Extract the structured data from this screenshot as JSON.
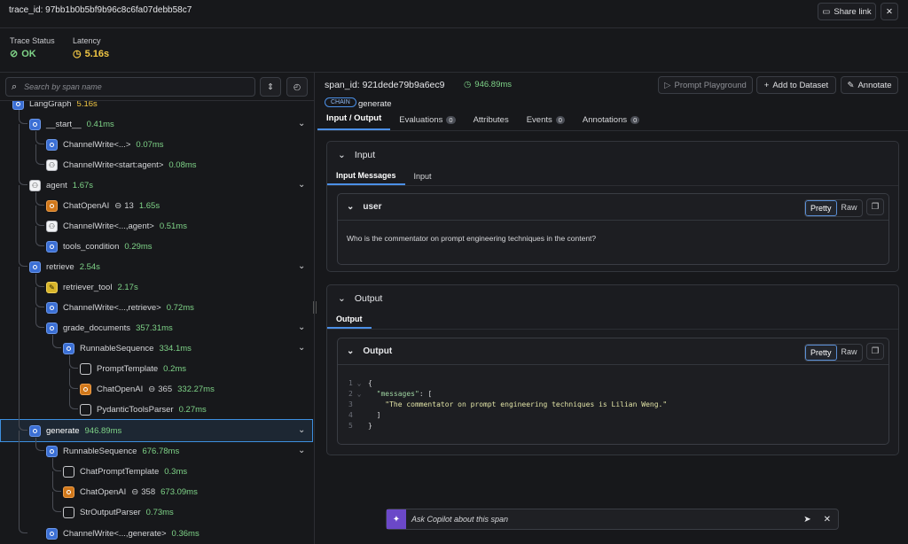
{
  "topbar": {
    "trace_id": "trace_id: 97bb1b0b5bf9b96c8c6fa07debb58c7",
    "share_label": "Share link"
  },
  "stats": {
    "status_label": "Trace Status",
    "status_value": "OK",
    "latency_label": "Latency",
    "latency_value": "5.16s"
  },
  "search": {
    "placeholder": "Search by span name"
  },
  "tree": [
    {
      "name": "LangGraph",
      "latency": "5.16s",
      "icon": "chain-icon"
    },
    {
      "name": "__start__",
      "latency": "0.41ms"
    },
    {
      "name": "ChannelWrite<...>",
      "latency": "0.07ms"
    },
    {
      "name": "ChannelWrite<start:agent>",
      "latency": "0.08ms"
    },
    {
      "name": "agent",
      "latency": "1.67s"
    },
    {
      "name": "ChatOpenAI",
      "tokens": "13",
      "latency": "1.65s"
    },
    {
      "name": "ChannelWrite<...,agent>",
      "latency": "0.51ms"
    },
    {
      "name": "tools_condition",
      "latency": "0.29ms"
    },
    {
      "name": "retrieve",
      "latency": "2.54s"
    },
    {
      "name": "retriever_tool",
      "latency": "2.17s"
    },
    {
      "name": "ChannelWrite<...,retrieve>",
      "latency": "0.72ms"
    },
    {
      "name": "grade_documents",
      "latency": "357.31ms"
    },
    {
      "name": "RunnableSequence",
      "latency": "334.1ms"
    },
    {
      "name": "PromptTemplate",
      "latency": "0.2ms"
    },
    {
      "name": "ChatOpenAI",
      "tokens": "365",
      "latency": "332.27ms"
    },
    {
      "name": "PydanticToolsParser",
      "latency": "0.27ms"
    },
    {
      "name": "generate",
      "latency": "946.89ms"
    },
    {
      "name": "RunnableSequence",
      "latency": "676.78ms"
    },
    {
      "name": "ChatPromptTemplate",
      "latency": "0.3ms"
    },
    {
      "name": "ChatOpenAI",
      "tokens": "358",
      "latency": "673.09ms"
    },
    {
      "name": "StrOutputParser",
      "latency": "0.73ms"
    },
    {
      "name": "ChannelWrite<...,generate>",
      "latency": "0.36ms"
    }
  ],
  "span": {
    "id": "span_id: 921dede79b9a6ec9",
    "latency": "946.89ms",
    "kind_badge": "CHAIN",
    "name": "generate",
    "playground_label": "Prompt Playground",
    "add_dataset_label": "Add to Dataset",
    "annotate_label": "Annotate"
  },
  "tabs": [
    {
      "label": "Input / Output"
    },
    {
      "label": "Evaluations",
      "count": "0"
    },
    {
      "label": "Attributes"
    },
    {
      "label": "Events",
      "count": "0"
    },
    {
      "label": "Annotations",
      "count": "0"
    }
  ],
  "input_panel": {
    "title": "Input",
    "tabs": [
      "Input Messages",
      "Input"
    ],
    "message_role": "user",
    "pretty_label": "Pretty",
    "raw_label": "Raw",
    "message_text": "Who is the commentator on prompt engineering techniques in the content?"
  },
  "output_panel": {
    "title": "Output",
    "tab": "Output",
    "sub_title": "Output",
    "pretty_label": "Pretty",
    "raw_label": "Raw",
    "code": {
      "l1": "{",
      "key": "\"messages\"",
      "colon": ": [",
      "value": "\"The commentator on prompt engineering techniques is Lilian Weng.\"",
      "l4": "]",
      "l5": "}"
    }
  },
  "copilot": {
    "placeholder": "Ask Copilot about this span"
  },
  "colors": {
    "accent": "#4b8fe6",
    "ok": "#7fd488",
    "latency": "#f2c744"
  }
}
